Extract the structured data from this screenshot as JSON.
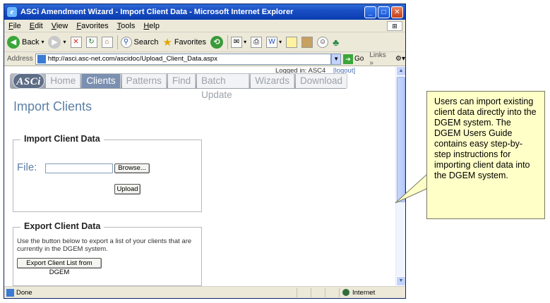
{
  "window": {
    "title": "ASCi Amendment Wizard - Import Client Data - Microsoft Internet Explorer",
    "controls": [
      "_",
      "□",
      "✕"
    ]
  },
  "menu": [
    "File",
    "Edit",
    "View",
    "Favorites",
    "Tools",
    "Help"
  ],
  "toolbar": {
    "back": "Back",
    "search": "Search",
    "favorites": "Favorites"
  },
  "address": {
    "label": "Address",
    "url": "http://asci.asc-net.com/ascidoc/Upload_Client_Data.aspx",
    "go": "Go",
    "links": "Links"
  },
  "page": {
    "login_text": "Logged in:  ASC4",
    "logout": "[logout]",
    "logo": "ASCi",
    "nav": [
      {
        "label": "Home",
        "active": false
      },
      {
        "label": "Clients",
        "active": true
      },
      {
        "label": "Patterns",
        "active": false
      },
      {
        "label": "Find",
        "active": false
      },
      {
        "label": "Batch Update",
        "active": false
      },
      {
        "label": "Wizards",
        "active": false
      },
      {
        "label": "Download",
        "active": false
      }
    ],
    "title": "Import Clients",
    "import": {
      "legend": "Import Client Data",
      "file_label": "File:",
      "browse": "Browse...",
      "upload": "Upload"
    },
    "export": {
      "legend": "Export Client Data",
      "description": "Use the button below to export a list of your clients that are currently in the DGEM system.",
      "button": "Export Client List from DGEM"
    }
  },
  "status": {
    "text": "Done",
    "zone": "Internet"
  },
  "callout": {
    "text": "Users can import existing client data directly into the DGEM system. The DGEM Users Guide contains easy step-by-step instructions for importing client data into the DGEM system."
  },
  "colors": {
    "accent": "#5c7fa6",
    "nav_active": "#7b8fb0",
    "callout_bg": "#ffffc8",
    "titlebar": "#0a3cb0"
  }
}
